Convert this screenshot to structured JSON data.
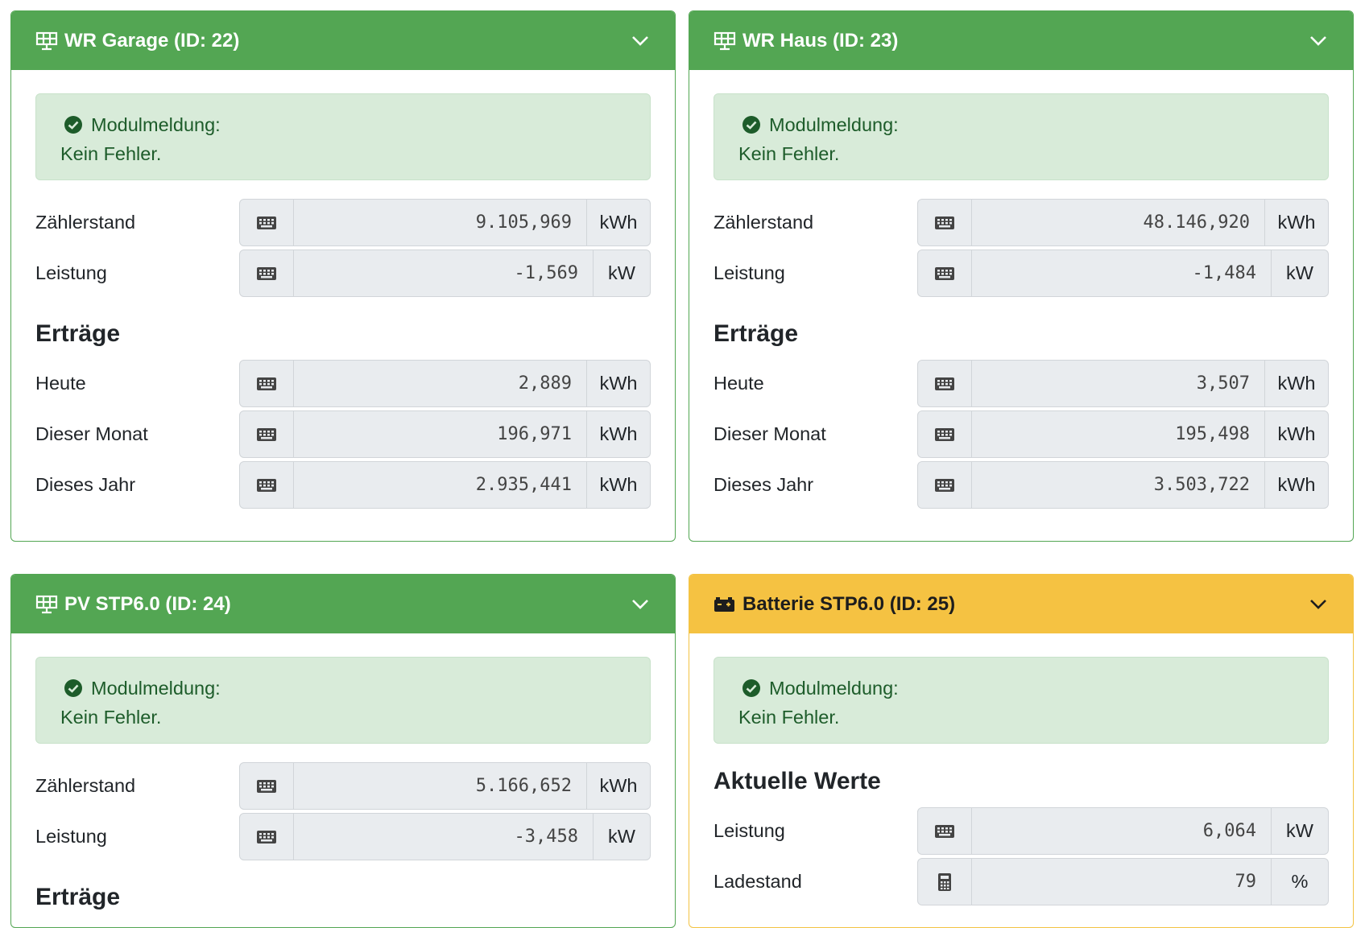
{
  "cards": {
    "wr_garage": {
      "title": "WR Garage (ID: 22)",
      "icon": "solar-panel-icon",
      "alert": {
        "heading": "Modulmeldung:",
        "text": "Kein Fehler."
      },
      "meter": {
        "label": "Zählerstand",
        "value": "9.105,969",
        "unit": "kWh"
      },
      "power": {
        "label": "Leistung",
        "value": "-1,569",
        "unit": "kW"
      },
      "yields_title": "Erträge",
      "today": {
        "label": "Heute",
        "value": "2,889",
        "unit": "kWh"
      },
      "month": {
        "label": "Dieser Monat",
        "value": "196,971",
        "unit": "kWh"
      },
      "year": {
        "label": "Dieses Jahr",
        "value": "2.935,441",
        "unit": "kWh"
      }
    },
    "wr_haus": {
      "title": "WR Haus (ID: 23)",
      "icon": "solar-panel-icon",
      "alert": {
        "heading": "Modulmeldung:",
        "text": "Kein Fehler."
      },
      "meter": {
        "label": "Zählerstand",
        "value": "48.146,920",
        "unit": "kWh"
      },
      "power": {
        "label": "Leistung",
        "value": "-1,484",
        "unit": "kW"
      },
      "yields_title": "Erträge",
      "today": {
        "label": "Heute",
        "value": "3,507",
        "unit": "kWh"
      },
      "month": {
        "label": "Dieser Monat",
        "value": "195,498",
        "unit": "kWh"
      },
      "year": {
        "label": "Dieses Jahr",
        "value": "3.503,722",
        "unit": "kWh"
      }
    },
    "pv_stp": {
      "title": "PV STP6.0 (ID: 24)",
      "icon": "solar-panel-icon",
      "alert": {
        "heading": "Modulmeldung:",
        "text": "Kein Fehler."
      },
      "meter": {
        "label": "Zählerstand",
        "value": "5.166,652",
        "unit": "kWh"
      },
      "power": {
        "label": "Leistung",
        "value": "-3,458",
        "unit": "kW"
      },
      "yields_title": "Erträge"
    },
    "batterie_stp": {
      "title": "Batterie STP6.0 (ID: 25)",
      "icon": "car-battery-icon",
      "alert": {
        "heading": "Modulmeldung:",
        "text": "Kein Fehler."
      },
      "current_title": "Aktuelle Werte",
      "power": {
        "label": "Leistung",
        "value": "6,064",
        "unit": "kW"
      },
      "soc": {
        "label": "Ladestand",
        "value": "79",
        "unit": "%"
      }
    }
  },
  "colors": {
    "success": "#53a653",
    "warning": "#f5c242",
    "alert_bg": "#d8ebd9",
    "alert_text": "#1d5c2a"
  }
}
